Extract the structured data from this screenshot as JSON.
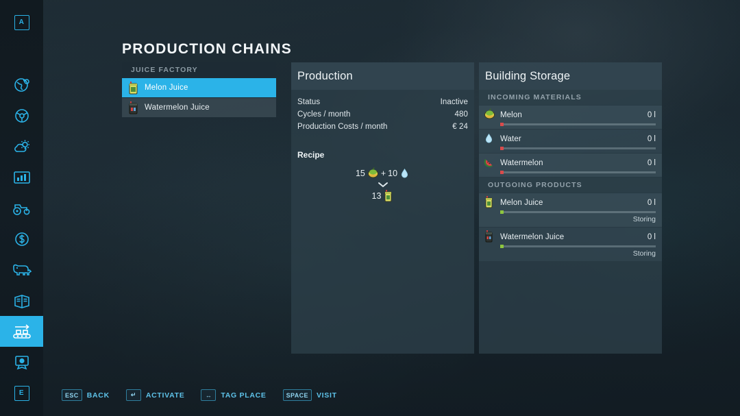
{
  "page": {
    "title": "PRODUCTION CHAINS"
  },
  "sidebar": {
    "items": [
      {
        "name": "key-a",
        "label": "A",
        "type": "keycap",
        "active": false
      },
      {
        "name": "map-globe",
        "label": "map-globe-icon",
        "type": "icon",
        "active": false
      },
      {
        "name": "vehicle-steering",
        "label": "steering-wheel-icon",
        "type": "icon",
        "active": false
      },
      {
        "name": "weather",
        "label": "weather-icon",
        "type": "icon",
        "active": false
      },
      {
        "name": "statistics",
        "label": "statistics-chart-icon",
        "type": "icon",
        "active": false
      },
      {
        "name": "vehicles",
        "label": "tractor-icon",
        "type": "icon",
        "active": false
      },
      {
        "name": "finances",
        "label": "money-dollar-icon",
        "type": "icon",
        "active": false
      },
      {
        "name": "animals",
        "label": "cow-icon",
        "type": "icon",
        "active": false
      },
      {
        "name": "contracts",
        "label": "documents-icon",
        "type": "icon",
        "active": false
      },
      {
        "name": "production",
        "label": "production-conveyor-icon",
        "type": "icon",
        "active": true
      },
      {
        "name": "achievements",
        "label": "achievement-icon",
        "type": "icon",
        "active": false
      },
      {
        "name": "key-e",
        "label": "E",
        "type": "keycap",
        "active": false
      }
    ]
  },
  "chain_list": {
    "group_label": "JUICE FACTORY",
    "items": [
      {
        "label": "Melon Juice",
        "icon": "melon-juice-bottle-icon",
        "selected": true
      },
      {
        "label": "Watermelon Juice",
        "icon": "watermelon-juice-bottle-icon",
        "selected": false
      }
    ]
  },
  "production": {
    "title": "Production",
    "stats": [
      {
        "label": "Status",
        "value": "Inactive"
      },
      {
        "label": "Cycles / month",
        "value": "480"
      },
      {
        "label": "Production Costs / month",
        "value": "€ 24"
      }
    ],
    "recipe": {
      "title": "Recipe",
      "inputs": [
        {
          "amount": "15",
          "icon": "melon-icon"
        },
        {
          "amount": "10",
          "icon": "water-drop-icon"
        }
      ],
      "plus": "+",
      "arrow": "chevron-down-icon",
      "outputs": [
        {
          "amount": "13",
          "icon": "melon-juice-bottle-icon"
        }
      ]
    }
  },
  "storage": {
    "title": "Building Storage",
    "incoming_label": "INCOMING MATERIALS",
    "outgoing_label": "OUTGOING PRODUCTS",
    "incoming": [
      {
        "name": "Melon",
        "amount": "0 l",
        "icon": "melon-icon",
        "fill": 0,
        "dot": "red"
      },
      {
        "name": "Water",
        "amount": "0 l",
        "icon": "water-drop-icon",
        "fill": 0,
        "dot": "red"
      },
      {
        "name": "Watermelon",
        "amount": "0 l",
        "icon": "watermelon-icon",
        "fill": 0,
        "dot": "red"
      }
    ],
    "outgoing": [
      {
        "name": "Melon Juice",
        "amount": "0 l",
        "status": "Storing",
        "icon": "melon-juice-bottle-icon",
        "fill": 0,
        "dot": "green"
      },
      {
        "name": "Watermelon Juice",
        "amount": "0 l",
        "status": "Storing",
        "icon": "watermelon-juice-bottle-icon",
        "fill": 0,
        "dot": "green"
      }
    ]
  },
  "help_bar": [
    {
      "key": "ESC",
      "label": "BACK"
    },
    {
      "key": "↵",
      "label": "ACTIVATE"
    },
    {
      "key": "↔",
      "label": "TAG PLACE"
    },
    {
      "key": "SPACE",
      "label": "VISIT"
    }
  ],
  "colors": {
    "accent": "#2bb3e8",
    "panel": "#2c3f49",
    "text": "#e9eff2",
    "muted": "#93a2ab",
    "red_dot": "#d94b4b",
    "green_dot": "#8ec63f"
  }
}
